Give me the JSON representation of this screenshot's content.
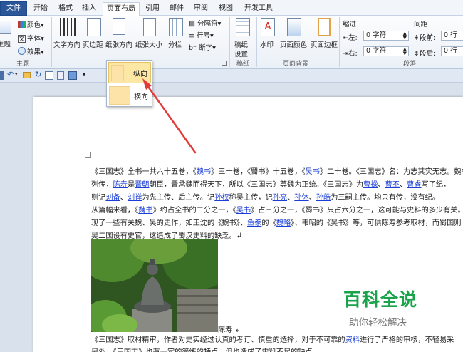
{
  "tabs": [
    "文件",
    "开始",
    "格式",
    "插入",
    "页面布局",
    "引用",
    "邮件",
    "审阅",
    "视图",
    "开发工具"
  ],
  "ribbon": {
    "themes": {
      "main": "主题",
      "colors": "颜色",
      "fonts": "字体",
      "effects": "效果",
      "group": "主题"
    },
    "setup": {
      "direction": "文字方向",
      "margins": "页边距",
      "orientation": "纸张方向",
      "size": "纸张大小",
      "columns": "分栏",
      "breaks": "分隔符",
      "line_numbers": "行号",
      "hyphenation": "断字"
    },
    "draft": {
      "label1": "稿纸",
      "label2": "设置",
      "group": "稿纸"
    },
    "background": {
      "watermark": "水印",
      "page_color": "页面颜色",
      "page_border": "页面边框",
      "group": "页面背景"
    },
    "paragraph": {
      "indent_title": "缩进",
      "spacing_title": "间距",
      "left_label": "左:",
      "right_label": "右:",
      "left_value": "0 字符",
      "right_value": "0 字符",
      "before_label": "段前:",
      "after_label": "段后:",
      "before_value": "0 行",
      "after_value": "0 行",
      "group": "段落"
    }
  },
  "dropdown": {
    "portrait": "纵向",
    "landscape": "横向"
  },
  "document": {
    "lines": [
      [
        {
          "t": "《三国志》全书一共六十五卷，《"
        },
        {
          "t": "魏书",
          "l": 1
        },
        {
          "t": "》三十卷，《蜀书》十五卷，《"
        },
        {
          "t": "吴书",
          "l": 1
        },
        {
          "t": "》二十卷。《三国志》名：为志其实无志。魏书有本纪、"
        }
      ],
      [
        {
          "t": "列传，"
        },
        {
          "t": "陈寿",
          "l": 1
        },
        {
          "t": "是"
        },
        {
          "t": "晋朝",
          "l": 1
        },
        {
          "t": "朝臣，晋承魏而得天下，所以《三国志》尊魏为正统。《三国志》为"
        },
        {
          "t": "曹操",
          "l": 1
        },
        {
          "t": "、"
        },
        {
          "t": "曹丕",
          "l": 1
        },
        {
          "t": "、"
        },
        {
          "t": "曹睿",
          "l": 1
        },
        {
          "t": "写了纪，"
        }
      ],
      [
        {
          "t": "则记"
        },
        {
          "t": "刘备",
          "l": 1
        },
        {
          "t": "、"
        },
        {
          "t": "刘禅",
          "l": 1
        },
        {
          "t": "为先主传、后主传。记"
        },
        {
          "t": "孙权",
          "l": 1
        },
        {
          "t": "称吴主传，记"
        },
        {
          "t": "孙亮",
          "l": 1
        },
        {
          "t": "、"
        },
        {
          "t": "孙休",
          "l": 1
        },
        {
          "t": "、"
        },
        {
          "t": "孙皓",
          "l": 1
        },
        {
          "t": "为三嗣主传。均只有传，没有纪。"
        }
      ],
      [
        {
          "t": "从篇幅来看，《"
        },
        {
          "t": "魏书",
          "l": 1
        },
        {
          "t": "》约占全书的二分之一，《"
        },
        {
          "t": "吴书",
          "l": 1
        },
        {
          "t": "》占三分之一，《蜀书》只占六分之一，这可能与史料的多少有关。"
        }
      ],
      [
        {
          "t": "现了一些有关魏、吴的史作，如王沈的《魏书》、"
        },
        {
          "t": "鱼豢",
          "l": 1
        },
        {
          "t": "的《"
        },
        {
          "t": "魏略",
          "l": 1
        },
        {
          "t": "》、韦昭的《吴书》等，可供陈寿参考取材，而蜀国则"
        }
      ],
      [
        {
          "t": "吴二国设有史官，这造成了蜀汉史料的缺乏。↲"
        }
      ]
    ],
    "caption": "陈寿 ↲",
    "lower": [
      [
        {
          "t": "《三国志》取材精审，作者对史实经过认真的考订、慎重的选择，对于不可靠的"
        },
        {
          "t": "资料",
          "l": 1
        },
        {
          "t": "进行了严格的审核，不轻易采"
        }
      ],
      [
        {
          "t": "另外，《三国志》也有一定的简练的特点，但也造成了史料不足的缺点。"
        }
      ]
    ]
  },
  "watermark": {
    "title": "百科全说",
    "subtitle": "助你轻松解决"
  },
  "colors": {
    "ribbon_bg": "#eaf0f7",
    "file_tab": "#2b579a",
    "link": "#1a3ed6",
    "watermark_green": "#1aa34a",
    "arrow_red": "#e23b3b",
    "highlight": "#fde7a4"
  }
}
